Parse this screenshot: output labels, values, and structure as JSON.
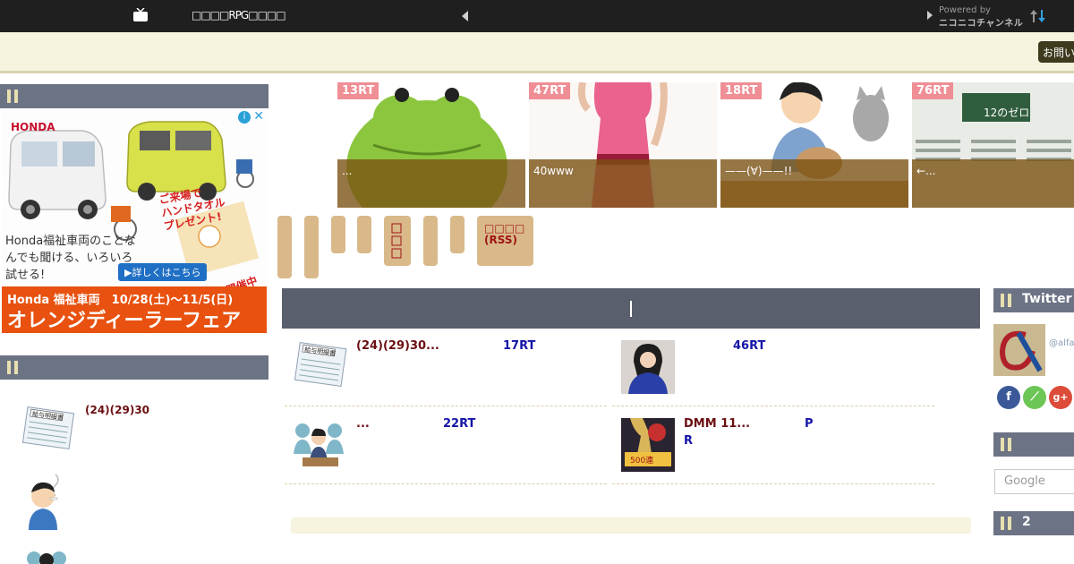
{
  "topbar": {
    "site_name": "□□□□RPG□□□□",
    "powered_by": "Powered by",
    "channel_name": "ニコニコチャンネル",
    "icons": [
      "tv-icon",
      "prev-arrow-icon",
      "next-arrow-icon",
      "sort-icon"
    ]
  },
  "header": {
    "contact_label": "お問い"
  },
  "left_column": {
    "ad": {
      "brand": "HONDA",
      "promo_lines": [
        "ご来場で",
        "ハンドタオル",
        "プレゼント!"
      ],
      "copy": "Honda福祉車両のことなんでも聞ける、いろいろ試せる!",
      "link_label": "▶詳しくはこちら",
      "badge": "開催中",
      "banner_line1": "Honda 福祉車両　10/28(土)〜11/5(日)",
      "banner_line2": "オレンジディーラーフェア"
    },
    "ranking": {
      "items": [
        {
          "title": "(24)(29)30",
          "thumb": "payslip-icon"
        },
        {
          "title": "",
          "thumb": "smoking-man-icon"
        },
        {
          "title": "",
          "thumb": "people-icon"
        }
      ]
    }
  },
  "carousel": {
    "slides": [
      {
        "rt": "13RT",
        "caption": "...",
        "thumb": "frog-illustration"
      },
      {
        "rt": "47RT",
        "caption": "40www",
        "thumb": "woman-dress-photo"
      },
      {
        "rt": "18RT",
        "caption": "——(∀)——!!",
        "thumb": "woman-cats-illustration"
      },
      {
        "rt": "76RT",
        "caption": "←...",
        "thumb": "slide-board-photo"
      }
    ]
  },
  "tags": {
    "rss_label_1": "□□□□",
    "rss_label_2": "(RSS)"
  },
  "articles": [
    {
      "title": "(24)(29)30...",
      "rt": "17RT",
      "thumb": "payslip-icon"
    },
    {
      "title": "",
      "rt": "46RT",
      "thumb": "portrait-photo"
    },
    {
      "title": "...",
      "rt": "22RT",
      "thumb": "meeting-illustration"
    },
    {
      "title": "DMM 11...",
      "rt": "P",
      "rt2": "R",
      "thumb": "game-banner"
    }
  ],
  "right_column": {
    "twitter_label": "Twitter",
    "twitter_handle": "@alfa",
    "search_placeholder": "Google",
    "section2_label": "2"
  },
  "colors": {
    "topbar": "#1f1f1f",
    "header_band": "#f6f3de",
    "section_head": "#6c7384",
    "rt_badge": "#ef8e95",
    "tag": "#d9b98a",
    "title_text": "#6b0f12",
    "rt_text": "#1414a8"
  }
}
